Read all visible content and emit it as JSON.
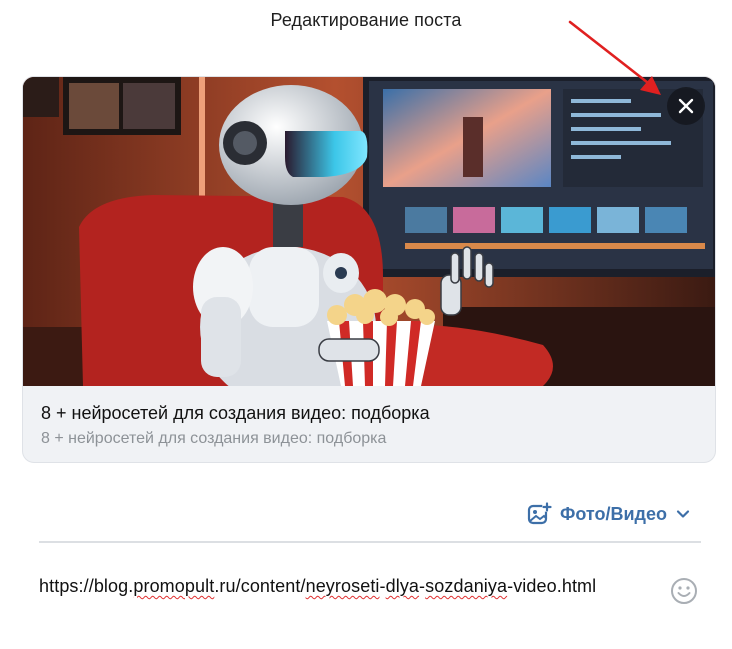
{
  "dialog": {
    "title": "Редактирование поста"
  },
  "attachment": {
    "image_alt": "robot watching video",
    "title": "8 + нейросетей для создания видео: подборка",
    "subtitle": "8 + нейросетей для создания видео: подборка",
    "close_icon": "close-icon"
  },
  "toolbar": {
    "media_label": "Фото/Видео",
    "media_icon": "photo-add-icon",
    "dropdown_icon": "chevron-down-icon"
  },
  "editor": {
    "url_parts": [
      "https://blog.",
      "promopult",
      ".ru/content/",
      "neyroseti",
      "-",
      "dlya",
      "-",
      "sozdaniya",
      "-video.html"
    ],
    "emoji_icon": "smile-icon"
  },
  "colors": {
    "accent": "#3d6fa8",
    "annotation_arrow": "#e02020"
  }
}
